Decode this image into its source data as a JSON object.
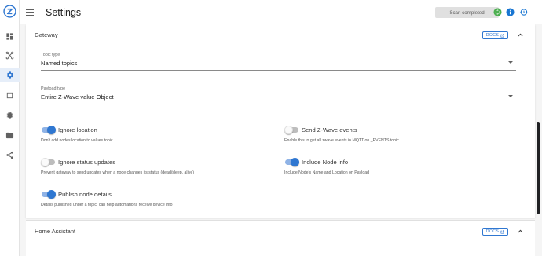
{
  "header": {
    "title": "Settings",
    "scan_status": "Scan completed",
    "icons": [
      "menu-icon",
      "sync-icon",
      "info-icon",
      "history-icon"
    ],
    "icon_colors": {
      "sync": "#4caf50",
      "info": "#1976d2",
      "history": "#1976d2"
    }
  },
  "rail": {
    "logo": "zwave-js-logo",
    "items": [
      {
        "icon": "dashboard-icon",
        "active": false
      },
      {
        "icon": "network-graph-icon",
        "active": false
      },
      {
        "icon": "settings-icon",
        "active": true
      },
      {
        "icon": "scenes-icon",
        "active": false
      },
      {
        "icon": "debug-icon",
        "active": false
      },
      {
        "icon": "folder-icon",
        "active": false
      },
      {
        "icon": "share-icon",
        "active": false
      }
    ]
  },
  "gateway": {
    "title": "Gateway",
    "docs_label": "DOCS",
    "topic_type": {
      "label": "Topic type",
      "value": "Named topics"
    },
    "payload_type": {
      "label": "Payload type",
      "value": "Entire Z-Wave value Object"
    },
    "toggles": {
      "ignore_location": {
        "label": "Ignore location",
        "hint": "Don't add nodes location to values topic",
        "on": true
      },
      "send_zwave_events": {
        "label": "Send Z-Wave events",
        "hint": "Enable this to get all zwave events in MQTT on _EVENTS topic",
        "on": false
      },
      "ignore_status_updates": {
        "label": "Ignore status updates",
        "hint": "Prevent gateway to send updates when a node changes its status (dead/sleep, alive)",
        "on": false
      },
      "include_node_info": {
        "label": "Include Node info",
        "hint": "Include Node's Name and Location on Payload",
        "on": true
      },
      "publish_node_details": {
        "label": "Publish node details",
        "hint": "Details published under a topic, can help automations receive device info",
        "on": true
      }
    }
  },
  "home_assistant": {
    "title": "Home Assistant",
    "docs_label": "DOCS"
  },
  "colors": {
    "accent": "#2f77d1"
  }
}
